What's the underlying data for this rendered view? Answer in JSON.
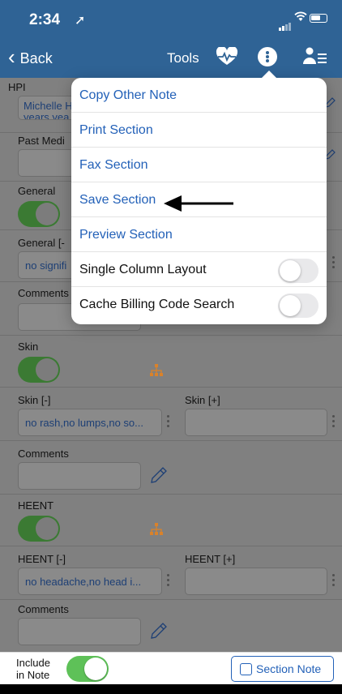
{
  "status": {
    "time": "2:34",
    "location_glyph": "➚"
  },
  "nav": {
    "back_label": "Back",
    "tools_label": "Tools"
  },
  "sections": {
    "hpi": {
      "label": "HPI",
      "value": "Michelle H",
      "value2": "years yea"
    },
    "pmh": {
      "label": "Past Medi"
    },
    "general": {
      "label": "General"
    },
    "general_neg": {
      "label": "General [-",
      "value": "no signifi"
    },
    "comments1": {
      "label": "Comments"
    },
    "skin": {
      "label": "Skin"
    },
    "skin_neg": {
      "label": "Skin [-]",
      "value": "no rash,no lumps,no so..."
    },
    "skin_pos": {
      "label": "Skin [+]",
      "value": ""
    },
    "comments2": {
      "label": "Comments"
    },
    "heent": {
      "label": "HEENT"
    },
    "heent_neg": {
      "label": "HEENT [-]",
      "value": "no headache,no head i..."
    },
    "heent_pos": {
      "label": "HEENT [+]",
      "value": ""
    },
    "comments3": {
      "label": "Comments"
    }
  },
  "menu": {
    "items": [
      {
        "label": "Copy Other Note"
      },
      {
        "label": "Print Section"
      },
      {
        "label": "Fax Section"
      },
      {
        "label": "Save Section"
      },
      {
        "label": "Preview Section"
      },
      {
        "label": "Single Column Layout",
        "toggle": false
      },
      {
        "label": "Cache Billing Code Search",
        "toggle": false
      }
    ]
  },
  "footer": {
    "include_line1": "Include",
    "include_line2": "in Note",
    "include_on": true,
    "section_note_label": "Section Note"
  },
  "colors": {
    "nav": "#2f6395",
    "link": "#2361b8",
    "toggle_on": "#5ec158",
    "tree_icon": "#d9822b"
  }
}
